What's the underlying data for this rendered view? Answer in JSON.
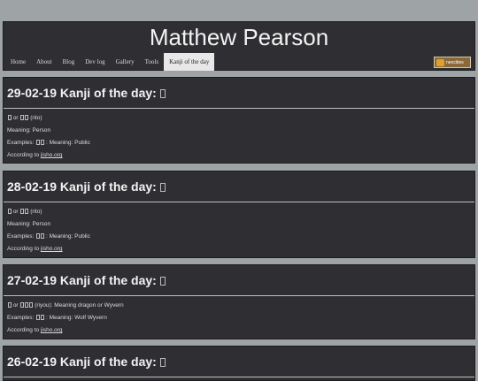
{
  "site": {
    "title": "Matthew Pearson"
  },
  "nav": {
    "items": [
      "Home",
      "About",
      "Blog",
      "Dev log",
      "Gallery",
      "Tools",
      "Kanji of the day"
    ],
    "active": "Kanji of the day"
  },
  "badge": {
    "text": "neocities",
    "alt": "neocities badge"
  },
  "posts": [
    {
      "title": "29-02-19 Kanji of the day: ",
      "reading": "(rito)",
      "meaning": "Meaning: Person",
      "examples_prefix": "Examples:",
      "examples_meaning": ": Meaning: Public",
      "according": "According to",
      "link": "jisho.org"
    },
    {
      "title": "28-02-19 Kanji of the day: ",
      "reading": "(rito)",
      "meaning": "Meaning: Person",
      "examples_prefix": "Examples:",
      "examples_meaning": ": Meaning: Public",
      "according": "According to",
      "link": "jisho.org"
    },
    {
      "title": "27-02-19 Kanji of the day: ",
      "reading": "(riyou): Meaning dragon or Wyvern",
      "meaning": "",
      "examples_prefix": "Examples:",
      "examples_meaning": ": Meaning: Wolf Wyvern",
      "according": "According to",
      "link": "jisho.org"
    },
    {
      "title": "26-02-19 Kanji of the day: "
    }
  ],
  "or_word": "or"
}
